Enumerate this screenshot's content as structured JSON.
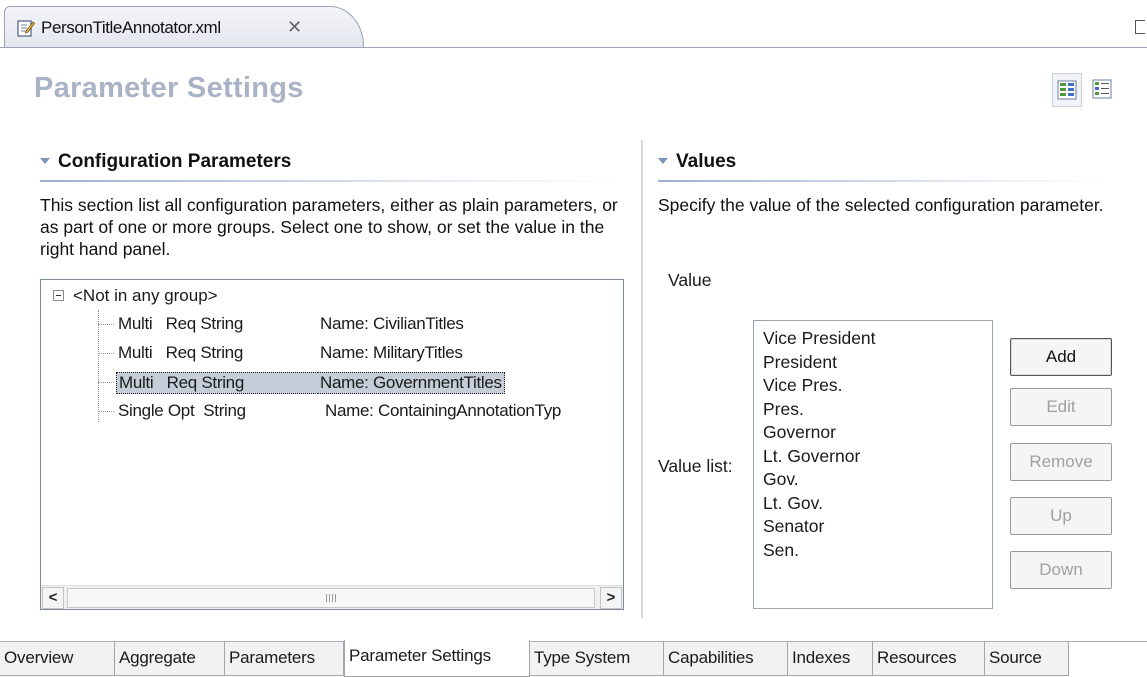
{
  "editor": {
    "tab_title": "PersonTitleAnnotator.xml",
    "close_glyph": "✕",
    "file_icon": "xml-file-edit-icon",
    "maximize_icon": "maximize-icon"
  },
  "page": {
    "title": "Parameter Settings",
    "layout_icons": [
      "horizontal-layout-icon",
      "vertical-layout-icon"
    ]
  },
  "config_params": {
    "title": "Configuration Parameters",
    "description": "This section list all configuration parameters, either as plain parameters, or as part of one or more groups.  Select one to show, or set the value in the right hand panel.",
    "tree": {
      "root_label": "<Not in any group>",
      "rows": [
        {
          "mods": "Multi   Req String",
          "name": "Name: CivilianTitles",
          "selected": false
        },
        {
          "mods": "Multi   Req String",
          "name": "Name: MilitaryTitles",
          "selected": false
        },
        {
          "mods": "Multi   Req String",
          "name": "Name: GovernmentTitles",
          "selected": true
        },
        {
          "mods": "Single Opt  String",
          "name": "Name: ContainingAnnotationTyp",
          "selected": false
        }
      ]
    },
    "scroll_left": "<",
    "scroll_right": ">"
  },
  "values": {
    "title": "Values",
    "description": "Specify the value of the selected configuration parameter.",
    "value_label": "Value",
    "value_list_label": "Value list:",
    "items": [
      "Vice President",
      "President",
      "Vice Pres.",
      "Pres.",
      "Governor",
      "Lt. Governor",
      "Gov.",
      "Lt. Gov.",
      "Senator",
      "Sen."
    ],
    "buttons": {
      "add": "Add",
      "edit": "Edit",
      "remove": "Remove",
      "up": "Up",
      "down": "Down"
    }
  },
  "page_tabs": [
    "Overview",
    "Aggregate",
    "Parameters",
    "Parameter Settings",
    "Type System",
    "Capabilities",
    "Indexes",
    "Resources",
    "Source"
  ],
  "active_page_tab": "Parameter Settings"
}
